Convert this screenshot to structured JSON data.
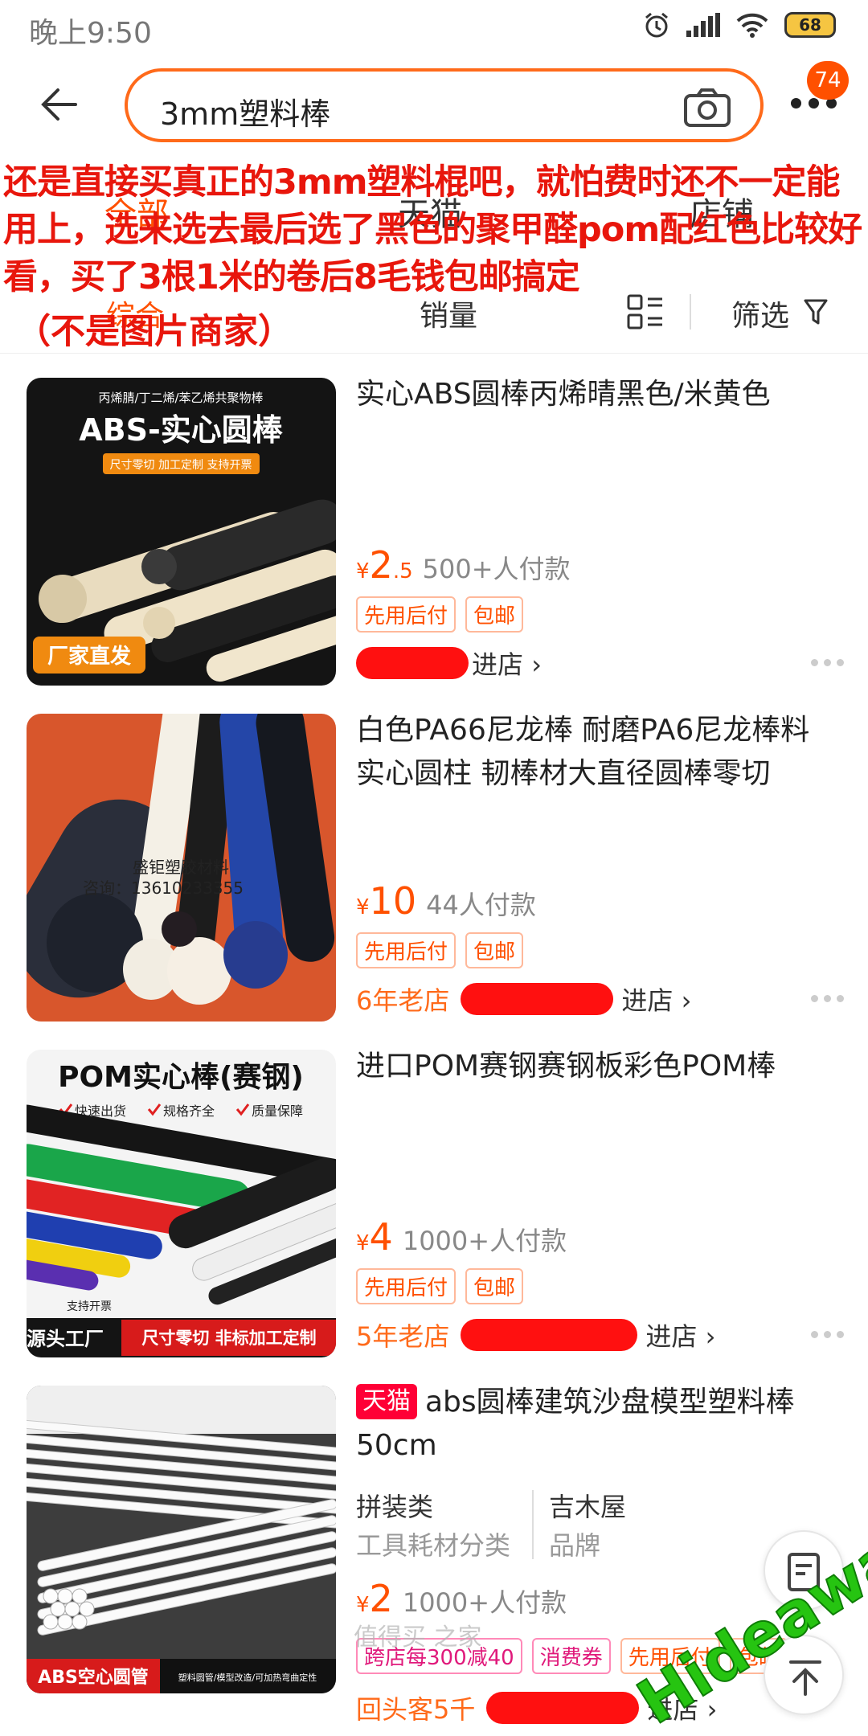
{
  "status": {
    "time": "晚上9:50",
    "battery": "68"
  },
  "header": {
    "search_query": "3mm塑料棒",
    "message_count": "74"
  },
  "tabs": [
    "全部",
    "天猫",
    "店铺"
  ],
  "sort": {
    "composite": "综合",
    "sales": "销量",
    "filter": "筛选"
  },
  "annotation": {
    "text": "还是直接买真正的3mm塑料棍吧，就怕费时还不一定能用上，选来选去最后选了黑色的聚甲醛pom配红色比较好看，买了3根1米的卷后8毛钱包邮搞定",
    "sub": "（不是图片商家）"
  },
  "products": [
    {
      "title": "实心ABS圆棒丙烯晴黑色/米黄色",
      "currency": "¥",
      "price_int": "2",
      "price_dec": ".5",
      "sales": "500+人付款",
      "tags": [
        "先用后付",
        "包邮"
      ],
      "shop_age": "",
      "enter": "进店",
      "thumb": {
        "top_line": "丙烯腈/丁二烯/苯乙烯共聚物棒",
        "heading": "ABS-实心圆棒",
        "strip": "尺寸零切  加工定制  支持开票",
        "badge": "厂家直发"
      }
    },
    {
      "title": "白色PA66尼龙棒 耐磨PA6尼龙棒料实心圆柱 韧棒材大直径圆棒零切",
      "currency": "¥",
      "price_int": "10",
      "price_dec": "",
      "sales": "44人付款",
      "tags": [
        "先用后付",
        "包邮"
      ],
      "shop_age": "6年老店",
      "enter": "进店",
      "thumb": {
        "line1": "盛钜塑胶材料",
        "line2": "咨询：13610233355"
      }
    },
    {
      "title": "进口POM赛钢赛钢板彩色POM棒",
      "currency": "¥",
      "price_int": "4",
      "price_dec": "",
      "sales": "1000+人付款",
      "tags": [
        "先用后付",
        "包邮"
      ],
      "shop_age": "5年老店",
      "enter": "进店",
      "thumb": {
        "heading": "POM实心棒(赛钢)",
        "checks": [
          "快速出货",
          "规格齐全",
          "质量保障"
        ],
        "support": "支持开票",
        "factory": "源头工厂",
        "strip": "尺寸零切  非标加工定制"
      }
    },
    {
      "badge": "天猫",
      "title": "abs圆棒建筑沙盘模型塑料棒50cm",
      "attrs": [
        {
          "value": "拼装类",
          "key": "工具耗材分类"
        },
        {
          "value": "吉木屋",
          "key": "品牌"
        }
      ],
      "currency": "¥",
      "price_int": "2",
      "price_dec": "",
      "sales": "1000+人付款",
      "tags": [
        "跨店每300减40",
        "消费券",
        "先用后付",
        "包邮"
      ],
      "shop_age": "回头客5千",
      "enter": "进店",
      "thumb": {
        "label": "ABS空心圆管",
        "strip": "塑料圆管/模型改造/可加热弯曲定性"
      }
    }
  ],
  "overlay": {
    "watermark": "Hideaway",
    "faint_mark": "值得买 之家"
  },
  "colors": {
    "accent": "#ff5000",
    "annotation": "#e8160c",
    "watermark": "#26c411"
  }
}
